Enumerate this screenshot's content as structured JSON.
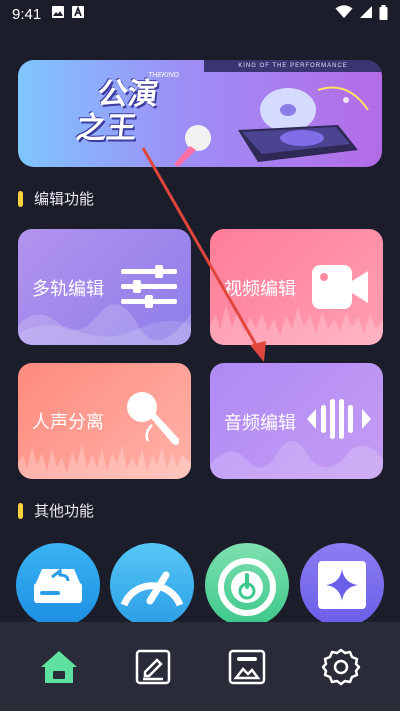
{
  "status_bar": {
    "time": "9:41"
  },
  "banner": {
    "title_line1": "公演",
    "title_line2": "之王",
    "subtitle": "THEKING",
    "tagline": "KING OF THE PERFORMANCE"
  },
  "sections": {
    "edit_title": "编辑功能",
    "other_title": "其他功能"
  },
  "cards": [
    {
      "label": "多轨编辑"
    },
    {
      "label": "视频编辑"
    },
    {
      "label": "人声分离"
    },
    {
      "label": "音频编辑"
    }
  ],
  "colors": {
    "background": "#1c1d2b",
    "accent_yellow": "#ffd23c",
    "nav_active": "#5ee0a0",
    "annotation_arrow": "#e0463c"
  }
}
